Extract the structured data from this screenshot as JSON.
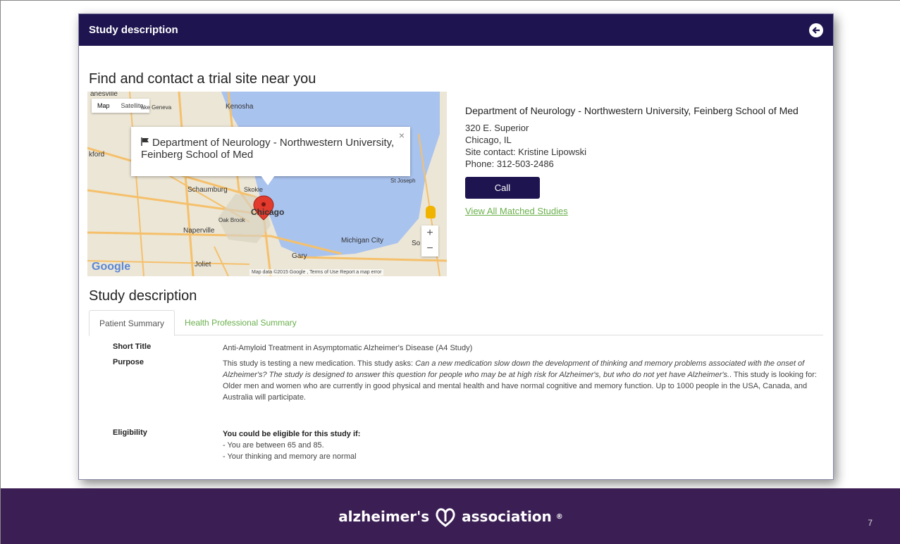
{
  "window": {
    "title": "Study description"
  },
  "find_heading": "Find and contact a trial site near you",
  "map": {
    "type_map": "Map",
    "type_satellite": "Satellite",
    "info_title": "Department of Neurology - Northwestern University, Feinberg School of Med",
    "info_close": "×",
    "labels": {
      "kenosha": "Kenosha",
      "janesville": "anesville",
      "lake_geneva": "ake Geneva",
      "rockford": "kford",
      "schaumburg": "Schaumburg",
      "skokie": "Skokie",
      "chicago": "Chicago",
      "oak_brook": "Oak Brook",
      "naperville": "Naperville",
      "joliet": "Joliet",
      "gary": "Gary",
      "michigan_city": "Michigan City",
      "st_joseph": "St Joseph",
      "so_be": "So Be"
    },
    "zoom_in": "+",
    "zoom_out": "−",
    "google": "Google",
    "attribution": "Map data ©2015 Google , Terms of Use   Report a map error"
  },
  "site": {
    "name": "Department of Neurology - Northwestern University, Feinberg School of Med",
    "address": "320 E. Superior",
    "city": "Chicago, IL",
    "contact": "Site contact: Kristine Lipowski",
    "phone": "Phone: 312-503-2486",
    "call_label": "Call",
    "view_all_label": "View All Matched Studies"
  },
  "study_heading": "Study description",
  "tabs": [
    {
      "label": "Patient Summary",
      "active": true
    },
    {
      "label": "Health Professional Summary",
      "active": false
    }
  ],
  "details": {
    "short_title_label": "Short Title",
    "short_title_value": "Anti-Amyloid Treatment in Asymptomatic Alzheimer's Disease (A4 Study)",
    "purpose_label": "Purpose",
    "purpose_p1": "This study is testing a new medication. This study asks: ",
    "purpose_p2": "Can a new medication slow down the development of thinking and memory problems associated with the onset of Alzheimer's? The study is designed to answer this question for people who may be at high risk for Alzheimer's, but who do not yet have Alzheimer's.",
    "purpose_p3": ". This study is looking for: Older men and women who are currently in good physical and mental health and have normal cognitive and memory function. Up to 1000 people in the USA, Canada, and Australia will participate.",
    "eligibility_label": "Eligibility",
    "eligibility_head": "You could be eligible for this study if:",
    "eligibility_item1": "- You are between 65 and 85.",
    "eligibility_item2": "- Your thinking and memory are normal"
  },
  "footer": {
    "logo_left": "alzheimer's",
    "logo_right": "association",
    "page_number": "7"
  },
  "colors": {
    "navy": "#1e1450",
    "purple": "#3b1f54",
    "green": "#6ab04c"
  }
}
